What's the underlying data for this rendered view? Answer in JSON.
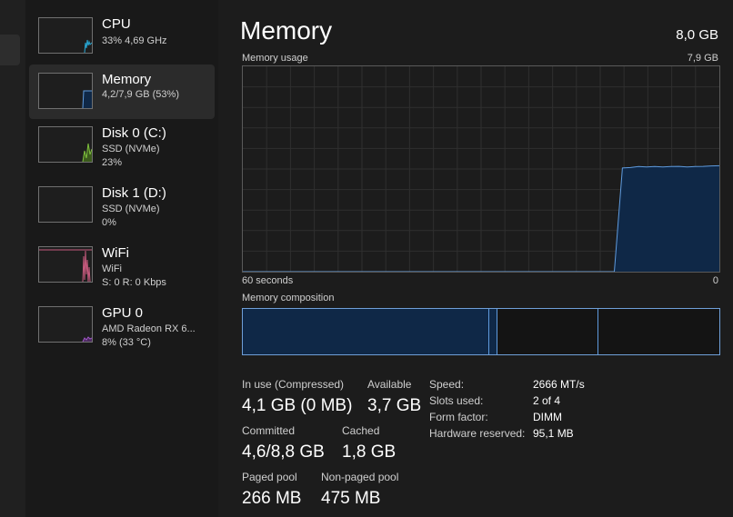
{
  "sidebar": {
    "items": [
      {
        "title": "CPU",
        "sub1": "33% 4,69 GHz",
        "sub2": ""
      },
      {
        "title": "Memory",
        "sub1": "4,2/7,9 GB (53%)",
        "sub2": ""
      },
      {
        "title": "Disk 0 (C:)",
        "sub1": "SSD (NVMe)",
        "sub2": "23%"
      },
      {
        "title": "Disk 1 (D:)",
        "sub1": "SSD (NVMe)",
        "sub2": "0%"
      },
      {
        "title": "WiFi",
        "sub1": "WiFi",
        "sub2": "S: 0 R: 0 Kbps"
      },
      {
        "title": "GPU 0",
        "sub1": "AMD Radeon RX 6...",
        "sub2": "8% (33 °C)"
      }
    ]
  },
  "header": {
    "title": "Memory",
    "total": "8,0 GB"
  },
  "usage_graph": {
    "label": "Memory usage",
    "max_label": "7,9 GB",
    "time_label": "60 seconds",
    "zero_label": "0",
    "usage_fraction_series": [
      0,
      0,
      0,
      0,
      0,
      0,
      0,
      0,
      0,
      0,
      0,
      0,
      0,
      0,
      0,
      0,
      0,
      0,
      0,
      0,
      0,
      0,
      0,
      0,
      0,
      0,
      0,
      0,
      0,
      0,
      0,
      0,
      0,
      0,
      0,
      0,
      0,
      0,
      0,
      0,
      0,
      0,
      0,
      0,
      0,
      0,
      0,
      0.505,
      0.507,
      0.512,
      0.51,
      0.512,
      0.51,
      0.512,
      0.513,
      0.51,
      0.512,
      0.513,
      0.515,
      0.516
    ]
  },
  "composition": {
    "label": "Memory composition",
    "segments_fraction": [
      0.518,
      0.016,
      0.213,
      0.253
    ]
  },
  "stats": {
    "in_use_label": "In use (Compressed)",
    "in_use_value": "4,1 GB (0 MB)",
    "available_label": "Available",
    "available_value": "3,7 GB",
    "committed_label": "Committed",
    "committed_value": "4,6/8,8 GB",
    "cached_label": "Cached",
    "cached_value": "1,8 GB",
    "paged_label": "Paged pool",
    "paged_value": "266 MB",
    "nonpaged_label": "Non-paged pool",
    "nonpaged_value": "475 MB"
  },
  "info": {
    "speed_label": "Speed:",
    "speed_value": "2666 MT/s",
    "slots_label": "Slots used:",
    "slots_value": "2 of 4",
    "form_label": "Form factor:",
    "form_value": "DIMM",
    "reserved_label": "Hardware reserved:",
    "reserved_value": "95,1 MB"
  },
  "colors": {
    "memory_line": "#5f9bde",
    "memory_fill": "#0f2847",
    "cpu": "#28a9d6",
    "disk": "#7ec03c",
    "wifi": "#c75a7e",
    "gpu": "#a055c8"
  }
}
